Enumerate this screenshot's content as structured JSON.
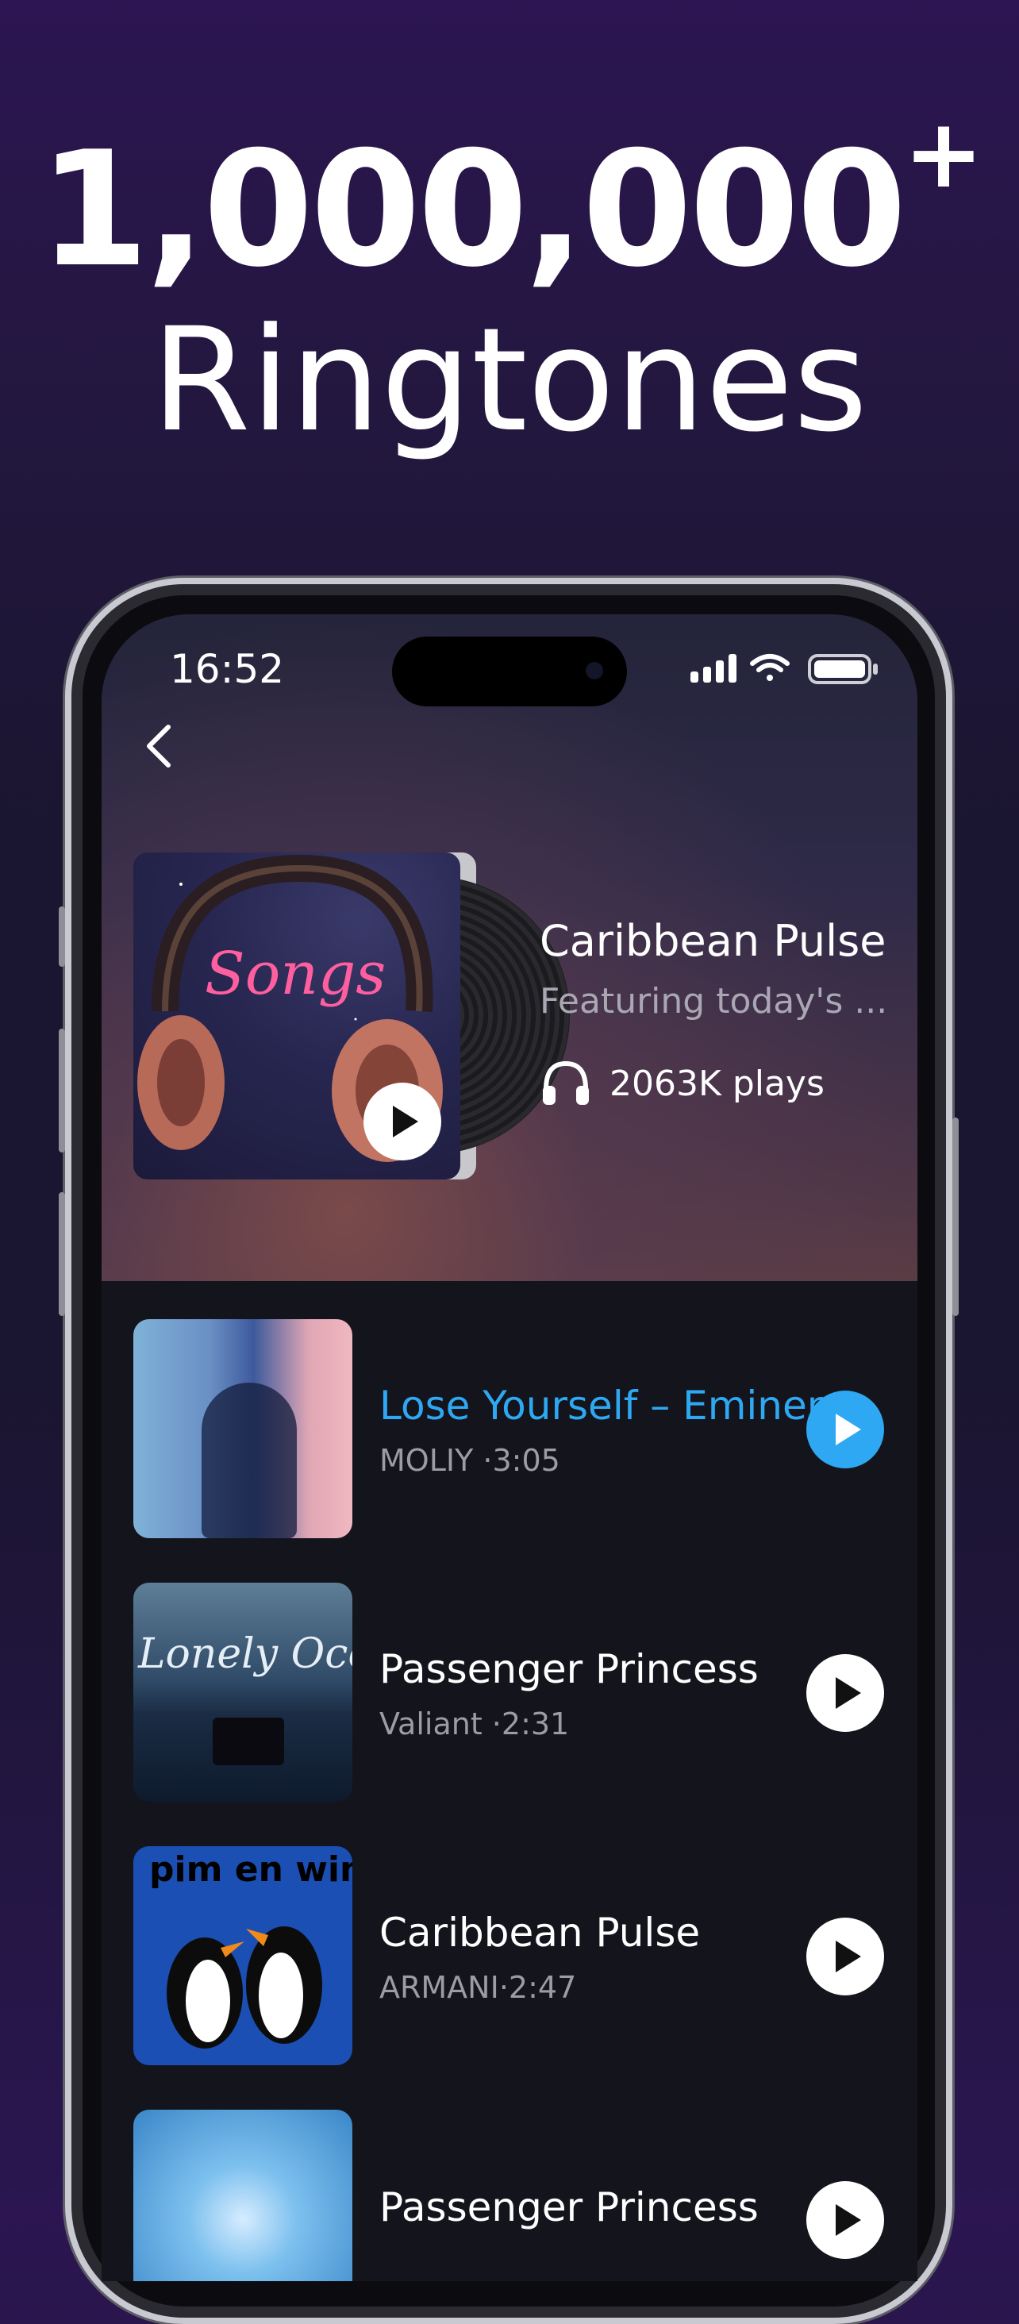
{
  "headline": {
    "count": "1,000,000",
    "plus": "+",
    "word": "Ringtones"
  },
  "status_bar": {
    "time": "16:52"
  },
  "playlist": {
    "title": "Caribbean Pulse",
    "subtitle": "Featuring today's ...",
    "plays": "2063K plays",
    "cover_text": "Songs"
  },
  "tracks": [
    {
      "title": "Lose Yourself – Eminem",
      "artist": "MOLIY",
      "duration": "3:05",
      "active": true
    },
    {
      "title": "Passenger Princess",
      "artist": "Valiant",
      "duration": "2:31",
      "active": false,
      "cover_text": "Lonely Ocean"
    },
    {
      "title": "Caribbean Pulse",
      "artist": "ARMANI",
      "duration": "2:47",
      "active": false,
      "cover_text": "pim en wim"
    },
    {
      "title": "Passenger Princess",
      "artist": "",
      "duration": "",
      "active": false
    }
  ],
  "colors": {
    "accent": "#2ea8f2",
    "background_top": "#2c1552",
    "list_background": "#14141c"
  }
}
